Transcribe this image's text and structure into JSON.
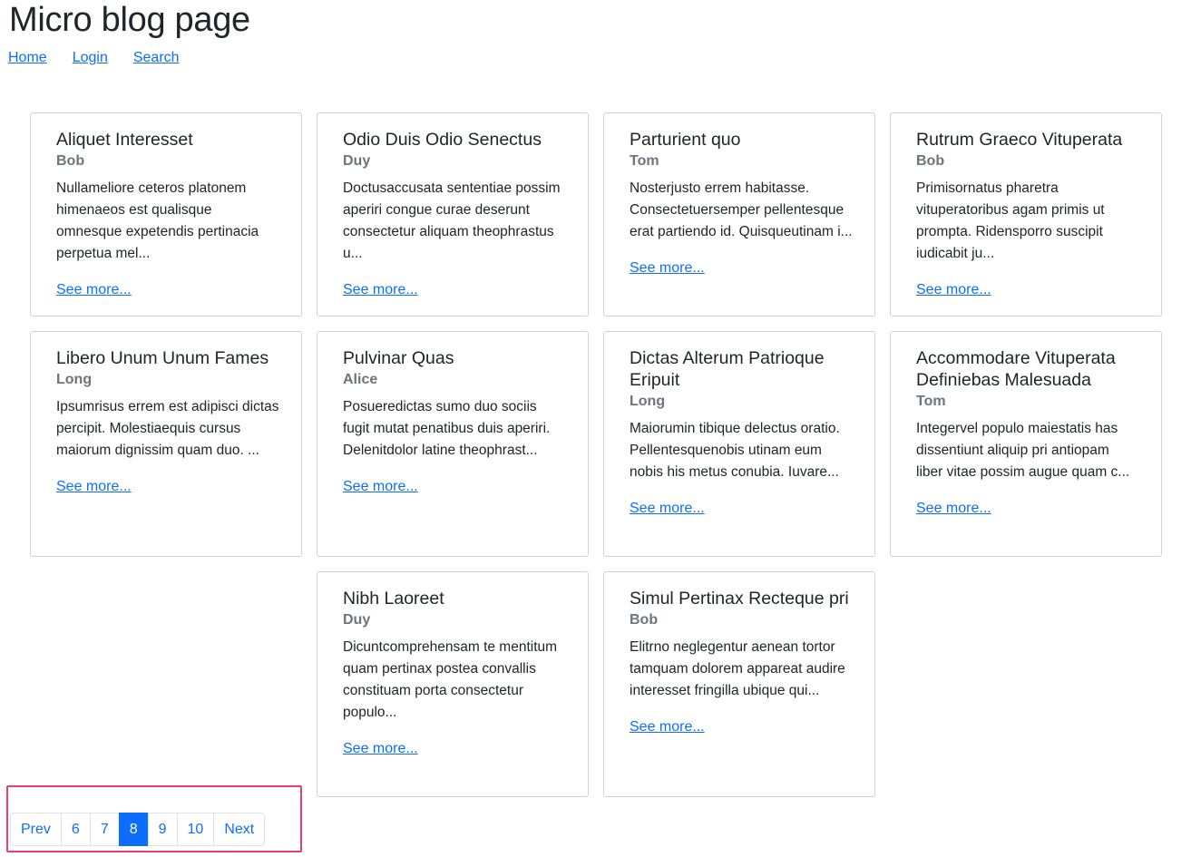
{
  "page": {
    "title": "Micro blog page"
  },
  "nav": {
    "links": [
      "Home",
      "Login",
      "Search"
    ]
  },
  "posts": [
    {
      "title": "Aliquet Interesset",
      "author": "Bob",
      "excerpt": "Nullameliore ceteros platonem himenaeos est qualisque omnesque expetendis pertinacia perpetua mel...",
      "link": "See more..."
    },
    {
      "title": "Odio Duis Odio Senectus",
      "author": "Duy",
      "excerpt": "Doctusaccusata sententiae possim aperiri congue curae deserunt consectetur aliquam theophrastus u...",
      "link": "See more..."
    },
    {
      "title": "Parturient quo",
      "author": "Tom",
      "excerpt": "Nosterjusto errem habitasse. Consectetuersemper pellentesque erat partiendo id. Quisqueutinam i...",
      "link": "See more..."
    },
    {
      "title": "Rutrum Graeco Vituperata",
      "author": "Bob",
      "excerpt": "Primisornatus pharetra vituperatoribus agam primis ut prompta. Ridensporro suscipit iudicabit ju...",
      "link": "See more..."
    },
    {
      "title": "Libero Unum Unum Fames",
      "author": "Long",
      "excerpt": "Ipsumrisus errem est adipisci dictas percipit. Molestiaequis cursus maiorum dignissim quam duo. ...",
      "link": "See more..."
    },
    {
      "title": "Pulvinar Quas",
      "author": "Alice",
      "excerpt": "Posueredictas sumo duo sociis fugit mutat penatibus duis aperiri. Delenitdolor latine theophrast...",
      "link": "See more..."
    },
    {
      "title": "Dictas Alterum Patrioque Eripuit",
      "author": "Long",
      "excerpt": "Maiorumin tibique delectus oratio. Pellentesquenobis utinam eum nobis his metus conubia. Iuvare...",
      "link": "See more..."
    },
    {
      "title": "Accommodare Vituperata Definiebas Malesuada",
      "author": "Tom",
      "excerpt": "Integervel populo maiestatis has dissentiunt aliquip pri antiopam liber vitae possim augue quam c...",
      "link": "See more..."
    },
    {
      "title": "Nibh Laoreet",
      "author": "Duy",
      "excerpt": "Dicuntcomprehensam te mentitum quam pertinax postea convallis constituam porta consectetur populo...",
      "link": "See more..."
    },
    {
      "title": "Simul Pertinax Recteque pri",
      "author": "Bob",
      "excerpt": "Elitrno neglegentur aenean tortor tamquam dolorem appareat audire interesset fringilla ubique qui...",
      "link": "See more..."
    }
  ],
  "pagination": {
    "prev": "Prev",
    "pages": [
      "6",
      "7",
      "8",
      "9",
      "10"
    ],
    "current": "8",
    "next": "Next",
    "highlight_color": "#e83e72",
    "active_color": "#0d6efd"
  }
}
